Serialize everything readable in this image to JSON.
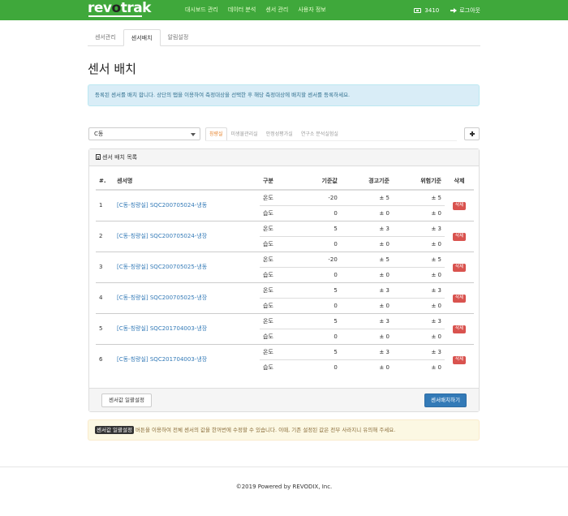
{
  "navbar": {
    "logo": {
      "prefix": "rev",
      "o": "o",
      "suffix": "trak"
    },
    "menu": [
      "대시보드 관리",
      "데이터 분석",
      "센서 관리",
      "사용자 정보"
    ],
    "count": "3410",
    "logout": "로그아웃"
  },
  "tabs": [
    "센서관리",
    "센서배치",
    "알림설정"
  ],
  "page_title": "센서 배치",
  "info_text": "등록된 센서를 배치 합니다. 상단의 탭을 이용하여 측정대상을 선택한 후 해당 측정대상에 배치할 센서를 등록하세요.",
  "filter": {
    "selected": "C동",
    "subtabs": [
      "칭량실",
      "미생물관리실",
      "안정성평가실",
      "연구소 분석실험실"
    ]
  },
  "panel": {
    "title": "센서 배치 목록",
    "columns": [
      "#.",
      "센서명",
      "구분",
      "기준값",
      "경고기준",
      "위험기준",
      "삭제"
    ],
    "rows": [
      {
        "no": "1",
        "name": "[C동-칭량실] SQC200705024-냉동",
        "temp": [
          "온도",
          "-20",
          "± 5",
          "± 5"
        ],
        "hum": [
          "습도",
          "0",
          "± 0",
          "± 0"
        ]
      },
      {
        "no": "2",
        "name": "[C동-칭량실] SQC200705024-냉장",
        "temp": [
          "온도",
          "5",
          "± 3",
          "± 3"
        ],
        "hum": [
          "습도",
          "0",
          "± 0",
          "± 0"
        ]
      },
      {
        "no": "3",
        "name": "[C동-칭량실] SQC200705025-냉동",
        "temp": [
          "온도",
          "-20",
          "± 5",
          "± 5"
        ],
        "hum": [
          "습도",
          "0",
          "± 0",
          "± 0"
        ]
      },
      {
        "no": "4",
        "name": "[C동-칭량실] SQC200705025-냉장",
        "temp": [
          "온도",
          "5",
          "± 3",
          "± 3"
        ],
        "hum": [
          "습도",
          "0",
          "± 0",
          "± 0"
        ]
      },
      {
        "no": "5",
        "name": "[C동-칭량실] SQC201704003-냉장",
        "temp": [
          "온도",
          "5",
          "± 3",
          "± 3"
        ],
        "hum": [
          "습도",
          "0",
          "± 0",
          "± 0"
        ]
      },
      {
        "no": "6",
        "name": "[C동-칭량실] SQC201704003-냉장",
        "temp": [
          "온도",
          "5",
          "± 3",
          "± 3"
        ],
        "hum": [
          "습도",
          "0",
          "± 0",
          "± 0"
        ]
      }
    ],
    "delete_label": "삭제",
    "bulk_button": "센서값 일괄설정",
    "save_button": "센서배치하기"
  },
  "warning": {
    "kbd": "센서값 일괄설정",
    "text": " 버튼을 이용하여 전체 센서의 값을 한꺼번에 수정할 수 있습니다. 이때, 기존 설정된 값은 전부 사라지니 유의해 주세요."
  },
  "footer": "©2019 Powered by REVODIX, Inc."
}
